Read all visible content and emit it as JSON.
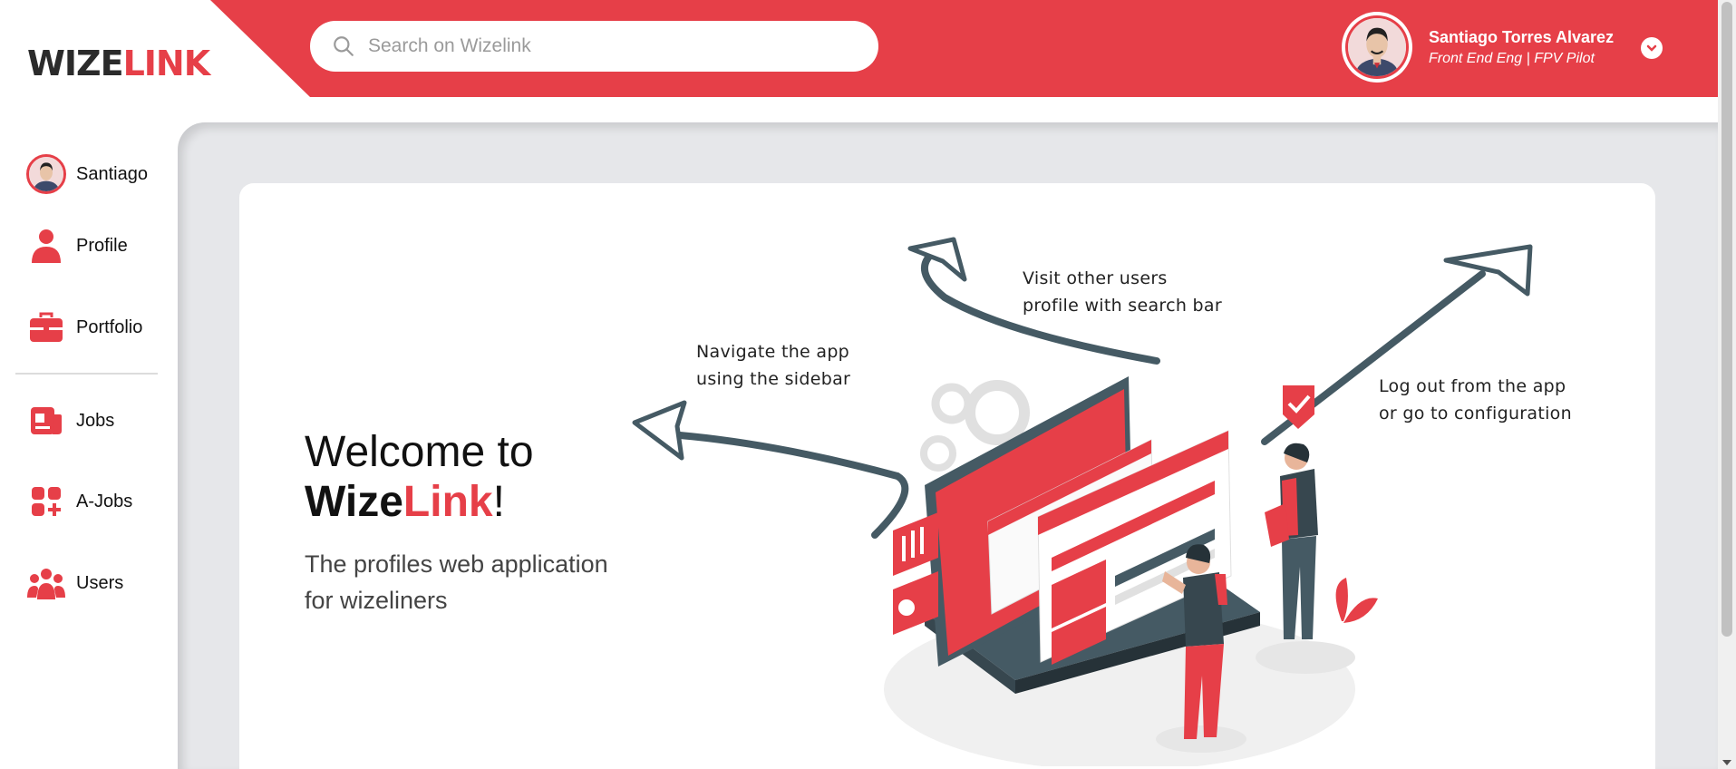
{
  "app": {
    "logo_part1": "WIZE",
    "logo_part2": "LINK"
  },
  "search": {
    "placeholder": "Search on Wizelink"
  },
  "user": {
    "name": "Santiago Torres Alvarez",
    "role": "Front End Eng | FPV Pilot"
  },
  "sidebar": {
    "items": [
      {
        "label": "Santiago",
        "icon": "avatar"
      },
      {
        "label": "Profile",
        "icon": "person-icon"
      },
      {
        "label": "Portfolio",
        "icon": "briefcase-icon"
      },
      {
        "label": "Jobs",
        "icon": "newspaper-icon"
      },
      {
        "label": "A-Jobs",
        "icon": "grid-plus-icon"
      },
      {
        "label": "Users",
        "icon": "users-icon"
      }
    ]
  },
  "hero": {
    "title_prefix": "Welcome to",
    "brand_part1": "Wize",
    "brand_part2": "Link",
    "brand_suffix": "!",
    "subtitle": "The profiles web application for wizeliners"
  },
  "notes": {
    "sidebar_line1": "Navigate the app",
    "sidebar_line2": "using the sidebar",
    "search_line1": "Visit other users",
    "search_line2": "profile with search bar",
    "logout_line1": "Log out from the app",
    "logout_line2": "or go to configuration"
  },
  "colors": {
    "accent": "#e63f48",
    "dark": "#2b2b2b",
    "main_bg": "#e6e7ea",
    "illustration_dark": "#455a64"
  }
}
